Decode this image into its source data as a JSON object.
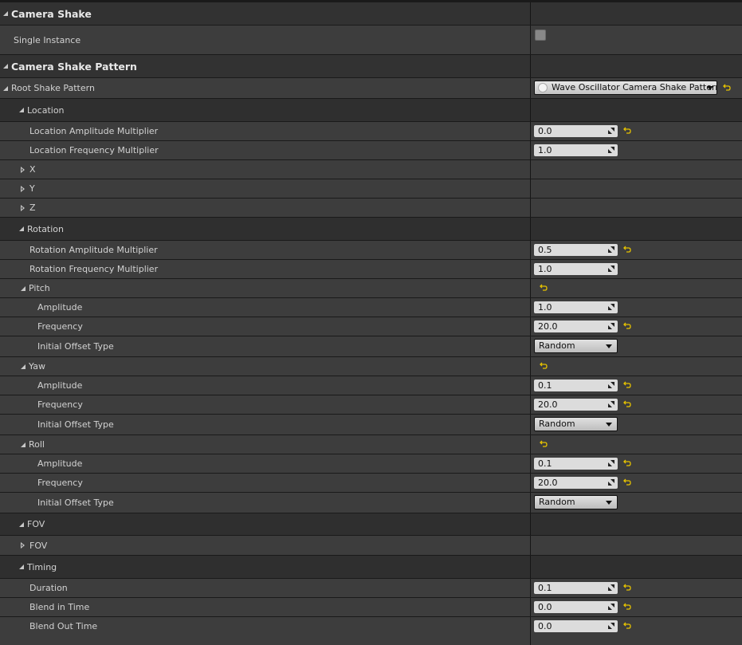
{
  "categories": {
    "camera_shake": "Camera Shake",
    "camera_shake_pattern": "Camera Shake Pattern"
  },
  "single_instance": {
    "label": "Single Instance",
    "checked": false
  },
  "root_shake_pattern": {
    "label": "Root Shake Pattern",
    "value": "Wave Oscillator Camera Shake Pattern"
  },
  "location": {
    "label": "Location",
    "amplitude_multiplier": {
      "label": "Location Amplitude Multiplier",
      "value": "0.0"
    },
    "frequency_multiplier": {
      "label": "Location Frequency Multiplier",
      "value": "1.0"
    },
    "x": "X",
    "y": "Y",
    "z": "Z"
  },
  "rotation": {
    "label": "Rotation",
    "amplitude_multiplier": {
      "label": "Rotation Amplitude Multiplier",
      "value": "0.5"
    },
    "frequency_multiplier": {
      "label": "Rotation Frequency Multiplier",
      "value": "1.0"
    },
    "pitch": {
      "label": "Pitch",
      "amplitude": {
        "label": "Amplitude",
        "value": "1.0"
      },
      "frequency": {
        "label": "Frequency",
        "value": "20.0"
      },
      "initial_offset_type": {
        "label": "Initial Offset Type",
        "value": "Random"
      }
    },
    "yaw": {
      "label": "Yaw",
      "amplitude": {
        "label": "Amplitude",
        "value": "0.1"
      },
      "frequency": {
        "label": "Frequency",
        "value": "20.0"
      },
      "initial_offset_type": {
        "label": "Initial Offset Type",
        "value": "Random"
      }
    },
    "roll": {
      "label": "Roll",
      "amplitude": {
        "label": "Amplitude",
        "value": "0.1"
      },
      "frequency": {
        "label": "Frequency",
        "value": "20.0"
      },
      "initial_offset_type": {
        "label": "Initial Offset Type",
        "value": "Random"
      }
    }
  },
  "fov": {
    "label": "FOV",
    "child": "FOV"
  },
  "timing": {
    "label": "Timing",
    "duration": {
      "label": "Duration",
      "value": "0.1"
    },
    "blend_in": {
      "label": "Blend in Time",
      "value": "0.0"
    },
    "blend_out": {
      "label": "Blend Out Time",
      "value": "0.0"
    }
  },
  "colors": {
    "reset_arrow": "#e6c200",
    "field_bg": "#dcdcdc",
    "row_bg": "#3d3d3d",
    "category_bg": "#323232"
  }
}
